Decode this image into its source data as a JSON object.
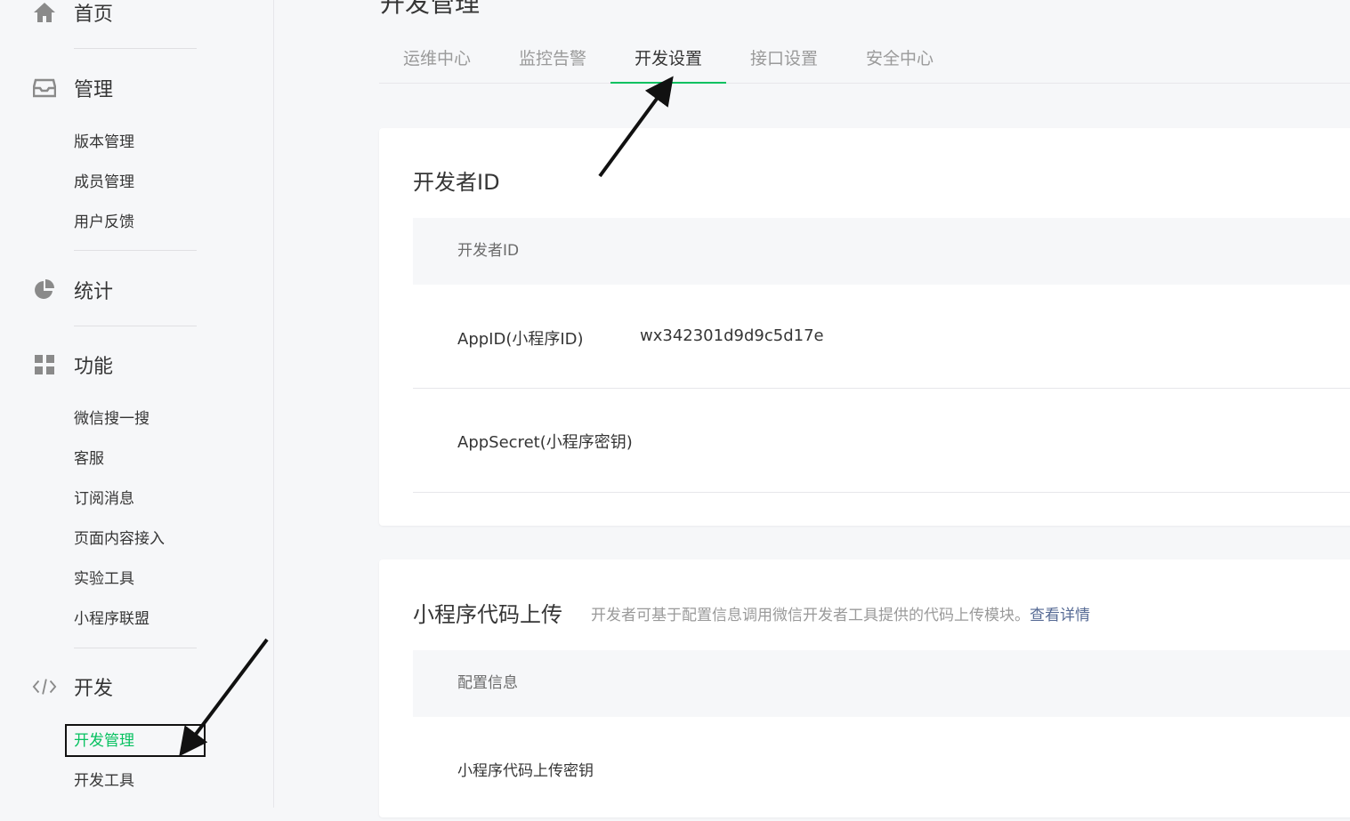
{
  "page": {
    "title": "开发管理"
  },
  "sidebar": {
    "home": {
      "label": "首页",
      "icon": "home-icon"
    },
    "manage": {
      "label": "管理",
      "icon": "inbox-icon",
      "items": [
        "版本管理",
        "成员管理",
        "用户反馈"
      ]
    },
    "stats": {
      "label": "统计",
      "icon": "pie-chart-icon"
    },
    "features": {
      "label": "功能",
      "icon": "grid-icon",
      "items": [
        "微信搜一搜",
        "客服",
        "订阅消息",
        "页面内容接入",
        "实验工具",
        "小程序联盟"
      ]
    },
    "develop": {
      "label": "开发",
      "icon": "code-icon",
      "items": [
        "开发管理",
        "开发工具"
      ],
      "active_item": "开发管理"
    }
  },
  "tabs": [
    {
      "label": "运维中心",
      "active": false
    },
    {
      "label": "监控告警",
      "active": false
    },
    {
      "label": "开发设置",
      "active": true
    },
    {
      "label": "接口设置",
      "active": false
    },
    {
      "label": "安全中心",
      "active": false
    }
  ],
  "developer_id_card": {
    "title": "开发者ID",
    "table_header": "开发者ID",
    "rows": [
      {
        "key": "AppID(小程序ID)",
        "value": "wx342301d9d9c5d17e"
      },
      {
        "key": "AppSecret(小程序密钥)",
        "value": ""
      }
    ]
  },
  "upload_card": {
    "title": "小程序代码上传",
    "description": "开发者可基于配置信息调用微信开发者工具提供的代码上传模块。",
    "link_label": "查看详情",
    "table_header": "配置信息",
    "rows": [
      {
        "key": "小程序代码上传密钥",
        "value": ""
      }
    ]
  },
  "colors": {
    "accent": "#07c160",
    "link": "#576b95",
    "annotation": "#111111"
  }
}
